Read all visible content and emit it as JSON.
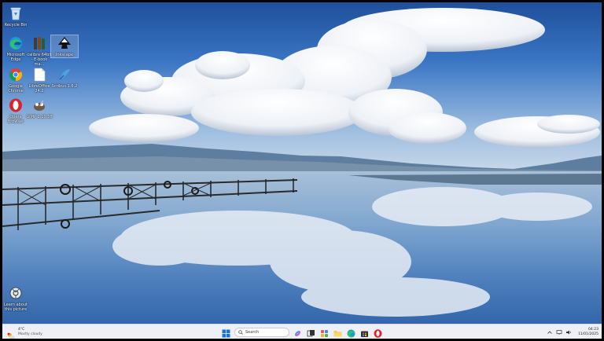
{
  "desktop": {
    "icons": [
      {
        "name": "recycle-bin",
        "label": "Recycle Bin"
      },
      {
        "name": "microsoft-edge",
        "label": "Microsoft Edge"
      },
      {
        "name": "calibre",
        "label": "calibre 64bit - E-book ma..."
      },
      {
        "name": "inkscape",
        "label": "Inkscape"
      },
      {
        "name": "google-chrome",
        "label": "Google Chrome"
      },
      {
        "name": "libreoffice",
        "label": "LibreOffice 24.2"
      },
      {
        "name": "scribus",
        "label": "Scribus 1.6.2"
      },
      {
        "name": "opera",
        "label": "Opera Browser"
      },
      {
        "name": "gimp",
        "label": "GIMP 2.10.38"
      },
      {
        "name": "learn-about-picture",
        "label": "Learn about this picture"
      }
    ]
  },
  "taskbar": {
    "weather": {
      "temp": "4°C",
      "condition": "Mostly cloudy"
    },
    "search_placeholder": "Search",
    "clock": {
      "time": "04:23",
      "date": "11/01/2025"
    }
  }
}
